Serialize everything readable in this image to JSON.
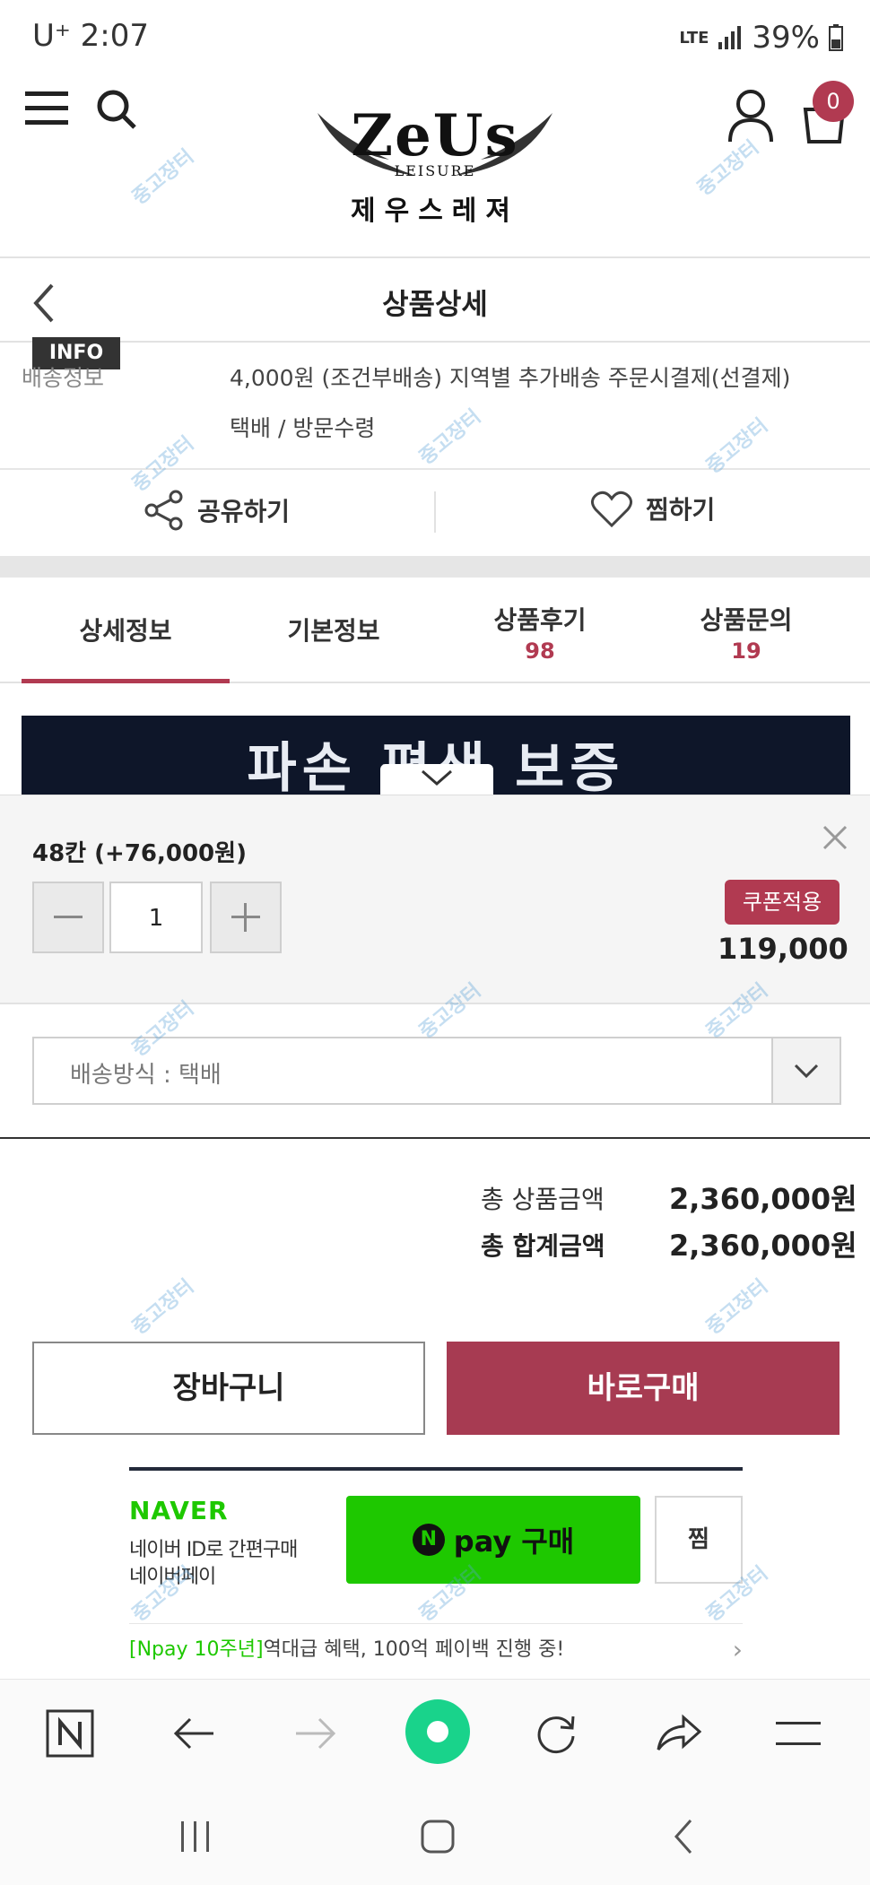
{
  "status_bar": {
    "carrier": "U⁺ 2:07",
    "network": "LTE",
    "battery": "39%"
  },
  "header": {
    "logo_title": "ZeUs",
    "logo_subtitle": "LEISURE",
    "logo_korean": "제우스레져",
    "cart_count": "0"
  },
  "title_bar": {
    "title": "상품상세"
  },
  "delivery": {
    "badge": "INFO",
    "label": "배송정보",
    "line1": "4,000원 (조건부배송) 지역별 추가배송 주문시결제(선결제)",
    "line2": "택배 / 방문수령"
  },
  "actions": {
    "share": "공유하기",
    "wish": "찜하기"
  },
  "tabs": [
    {
      "label": "상세정보",
      "count": ""
    },
    {
      "label": "기본정보",
      "count": ""
    },
    {
      "label": "상품후기",
      "count": "98"
    },
    {
      "label": "상품문의",
      "count": "19"
    }
  ],
  "banner": {
    "text": "파손 평생 보증"
  },
  "option": {
    "name": "48칸 (+76,000원)",
    "quantity": "1",
    "coupon": "쿠폰적용",
    "price": "119,000"
  },
  "shipping": {
    "selected": "배송방식 : 택배"
  },
  "totals": {
    "product_label": "총 상품금액",
    "product_value": "2,360,000원",
    "sum_label": "총 합계금액",
    "sum_value": "2,360,000원"
  },
  "buttons": {
    "cart": "장바구니",
    "buy": "바로구매"
  },
  "naver_pay": {
    "brand": "NAVER",
    "desc1": "네이버 ID로 간편구매",
    "desc2": "네이버페이",
    "n": "N",
    "pay": "pay 구매",
    "zzim": "찜",
    "promo_highlight": "[Npay 10주년]",
    "promo_text": "역대급 혜택, 100억 페이백 진행 중!"
  },
  "watermark": "중고장터",
  "colors": {
    "accent": "#b13a51",
    "buy_button": "#a73b52",
    "naver_green": "#1ec800",
    "browser_home": "#19d38b"
  }
}
